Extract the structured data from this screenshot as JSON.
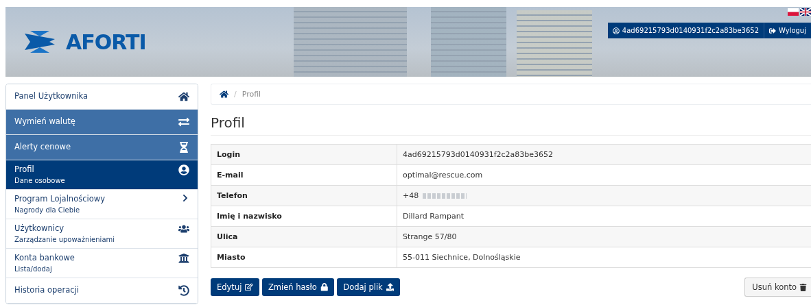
{
  "header": {
    "logo": "AFORTI",
    "user_button": "4ad69215793d0140931f2c2a83be3652",
    "logout_button": "Wyloguj"
  },
  "sidebar": {
    "items": [
      {
        "kind": "plain",
        "title": "Panel Użytkownika",
        "selected": false
      },
      {
        "kind": "accent",
        "title": "Wymień walutę",
        "selected": false
      },
      {
        "kind": "accent",
        "title": "Alerty cenowe",
        "selected": false
      },
      {
        "kind": "plain",
        "title": "Profil",
        "subtitle": "Dane osobowe",
        "selected": true
      },
      {
        "kind": "plain",
        "title": "Program Lojalnościowy",
        "subtitle": "Nagrody dla Ciebie",
        "selected": false
      },
      {
        "kind": "plain",
        "title": "Użytkownicy",
        "subtitle": "Zarządzanie upoważnieniami",
        "selected": false
      },
      {
        "kind": "plain",
        "title": "Konta bankowe",
        "subtitle": "Lista/dodaj",
        "selected": false
      },
      {
        "kind": "plain",
        "title": "Historia operacji",
        "selected": false
      }
    ]
  },
  "breadcrumb": {
    "separator": "/",
    "current": "Profil"
  },
  "page_title": "Profil",
  "table": {
    "rows": [
      {
        "label": "Login",
        "value": "4ad69215793d0140931f2c2a83be3652"
      },
      {
        "label": "E-mail",
        "value": "optimal@rescue.com"
      },
      {
        "label": "Telefon",
        "value": "+48",
        "redacted": true
      },
      {
        "label": "Imię i nazwisko",
        "value": "Dillard Rampant"
      },
      {
        "label": "Ulica",
        "value": "Strange 57/80"
      },
      {
        "label": "Miasto",
        "value": "55-011 Siechnice, Dolnośląskie"
      }
    ]
  },
  "buttons": [
    {
      "label": "Edytuj"
    },
    {
      "label": "Zmień hasło"
    },
    {
      "label": "Dodaj plik"
    }
  ],
  "delete_button": "Usuń konto"
}
